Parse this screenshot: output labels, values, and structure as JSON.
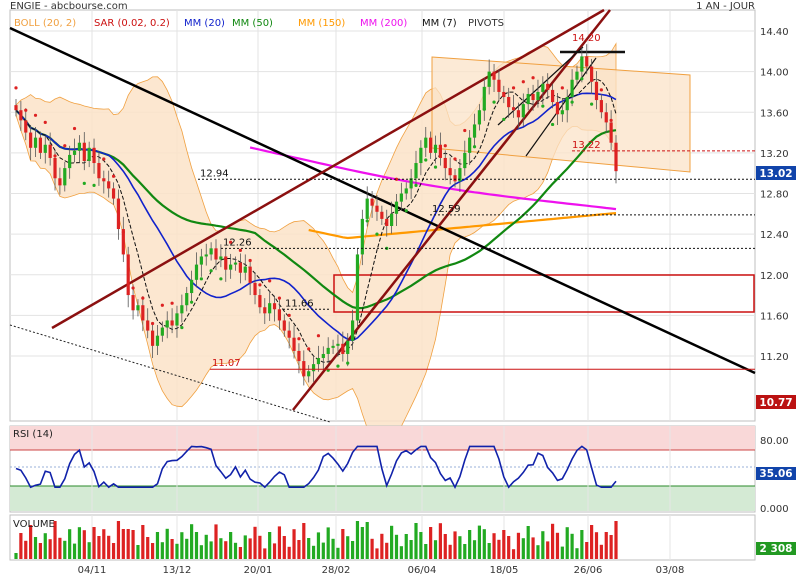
{
  "header": {
    "title": "ENGIE - abcbourse.com",
    "period": "1 AN - JOUR"
  },
  "legend": [
    {
      "label": "BOLL (20, 2)",
      "color": "#f0a040"
    },
    {
      "label": "SAR (0.02, 0.2)",
      "color": "#cc1111"
    },
    {
      "label": "MM (20)",
      "color": "#1122cc"
    },
    {
      "label": "MM (50)",
      "color": "#118811"
    },
    {
      "label": "MM (150)",
      "color": "#ff9900"
    },
    {
      "label": "MM (200)",
      "color": "#ee11ee"
    },
    {
      "label": "MM (7)",
      "color": "#111111"
    },
    {
      "label": "PIVOTS",
      "color": "#333333"
    }
  ],
  "colors": {
    "up": "#22aa22",
    "down": "#dd2222",
    "boll": "#f0a040",
    "boll_fill": "#fbe3c8",
    "trend_dark": "#8b1010",
    "trend_black": "#000000",
    "rsi_line": "#1122aa",
    "price_badge_current": "#1144aa",
    "price_badge_low": "#bb1111"
  },
  "price_labels": {
    "ticks": [
      "14.40",
      "14.00",
      "13.60",
      "13.20",
      "12.80",
      "12.40",
      "12.00",
      "11.60",
      "11.20"
    ],
    "current": "13.02",
    "low": "10.77"
  },
  "annotations": [
    {
      "text": "14.20",
      "color": "#cc1111"
    },
    {
      "text": "13.22",
      "color": "#cc1111"
    },
    {
      "text": "12.94",
      "color": "#111111"
    },
    {
      "text": "12.59",
      "color": "#111111"
    },
    {
      "text": "12.26",
      "color": "#111111"
    },
    {
      "text": "11.66",
      "color": "#111111"
    },
    {
      "text": "11.07",
      "color": "#cc1111"
    }
  ],
  "rsi": {
    "label": "RSI (14)",
    "ticks": [
      "80.00",
      "0.000"
    ],
    "current": "35.06"
  },
  "volume": {
    "label": "VOLUME",
    "current": "2 308"
  },
  "x_ticks": [
    "04/11",
    "13/12",
    "20/01",
    "28/02",
    "06/04",
    "18/05",
    "26/06",
    "03/08"
  ],
  "chart_data": {
    "type": "candlestick",
    "title": "ENGIE - abcbourse.com",
    "period": "1 AN - JOUR",
    "y_range": [
      10.77,
      14.5
    ],
    "x_ticks": [
      "04/11",
      "13/12",
      "20/01",
      "28/02",
      "06/04",
      "18/05",
      "26/06",
      "03/08"
    ],
    "closes": [
      13.62,
      13.52,
      13.4,
      13.25,
      13.35,
      13.2,
      13.28,
      13.15,
      12.95,
      12.88,
      13.05,
      13.18,
      13.22,
      13.3,
      13.12,
      13.25,
      13.1,
      12.95,
      12.92,
      12.85,
      12.75,
      12.45,
      12.2,
      11.8,
      11.65,
      11.7,
      11.55,
      11.45,
      11.3,
      11.4,
      11.48,
      11.55,
      11.5,
      11.62,
      11.7,
      11.82,
      11.95,
      12.1,
      12.18,
      12.2,
      12.26,
      12.15,
      12.18,
      12.05,
      12.1,
      12.12,
      12.02,
      12.08,
      11.92,
      11.8,
      11.68,
      11.62,
      11.72,
      11.66,
      11.55,
      11.45,
      11.38,
      11.25,
      11.15,
      11.0,
      11.05,
      11.12,
      11.18,
      11.22,
      11.28,
      11.3,
      11.32,
      11.22,
      11.35,
      11.55,
      12.2,
      12.55,
      12.75,
      12.68,
      12.62,
      12.55,
      12.48,
      12.6,
      12.72,
      12.8,
      12.85,
      12.95,
      13.1,
      13.25,
      13.35,
      13.2,
      13.28,
      13.15,
      13.05,
      12.98,
      12.92,
      13.05,
      13.2,
      13.35,
      13.48,
      13.62,
      13.85,
      14.0,
      13.92,
      13.8,
      13.75,
      13.65,
      13.62,
      13.55,
      13.68,
      13.78,
      13.72,
      13.8,
      13.88,
      13.82,
      13.7,
      13.58,
      13.62,
      13.75,
      13.92,
      14.0,
      14.15,
      14.05,
      13.9,
      13.72,
      13.6,
      13.5,
      13.3,
      13.02
    ],
    "annotations": [
      "14.20",
      "13.22",
      "12.94",
      "12.59",
      "12.26",
      "11.66",
      "11.07"
    ],
    "current_price": 13.02,
    "low_marker": 10.77,
    "series": [
      {
        "name": "BOLL (20, 2)"
      },
      {
        "name": "SAR (0.02, 0.2)"
      },
      {
        "name": "MM (20)"
      },
      {
        "name": "MM (50)"
      },
      {
        "name": "MM (150)"
      },
      {
        "name": "MM (200)"
      },
      {
        "name": "MM (7)"
      }
    ],
    "rsi": {
      "name": "RSI (14)",
      "range": [
        0,
        100
      ],
      "current": 35.06
    },
    "volume": {
      "name": "VOLUME",
      "current": "2 308"
    }
  }
}
